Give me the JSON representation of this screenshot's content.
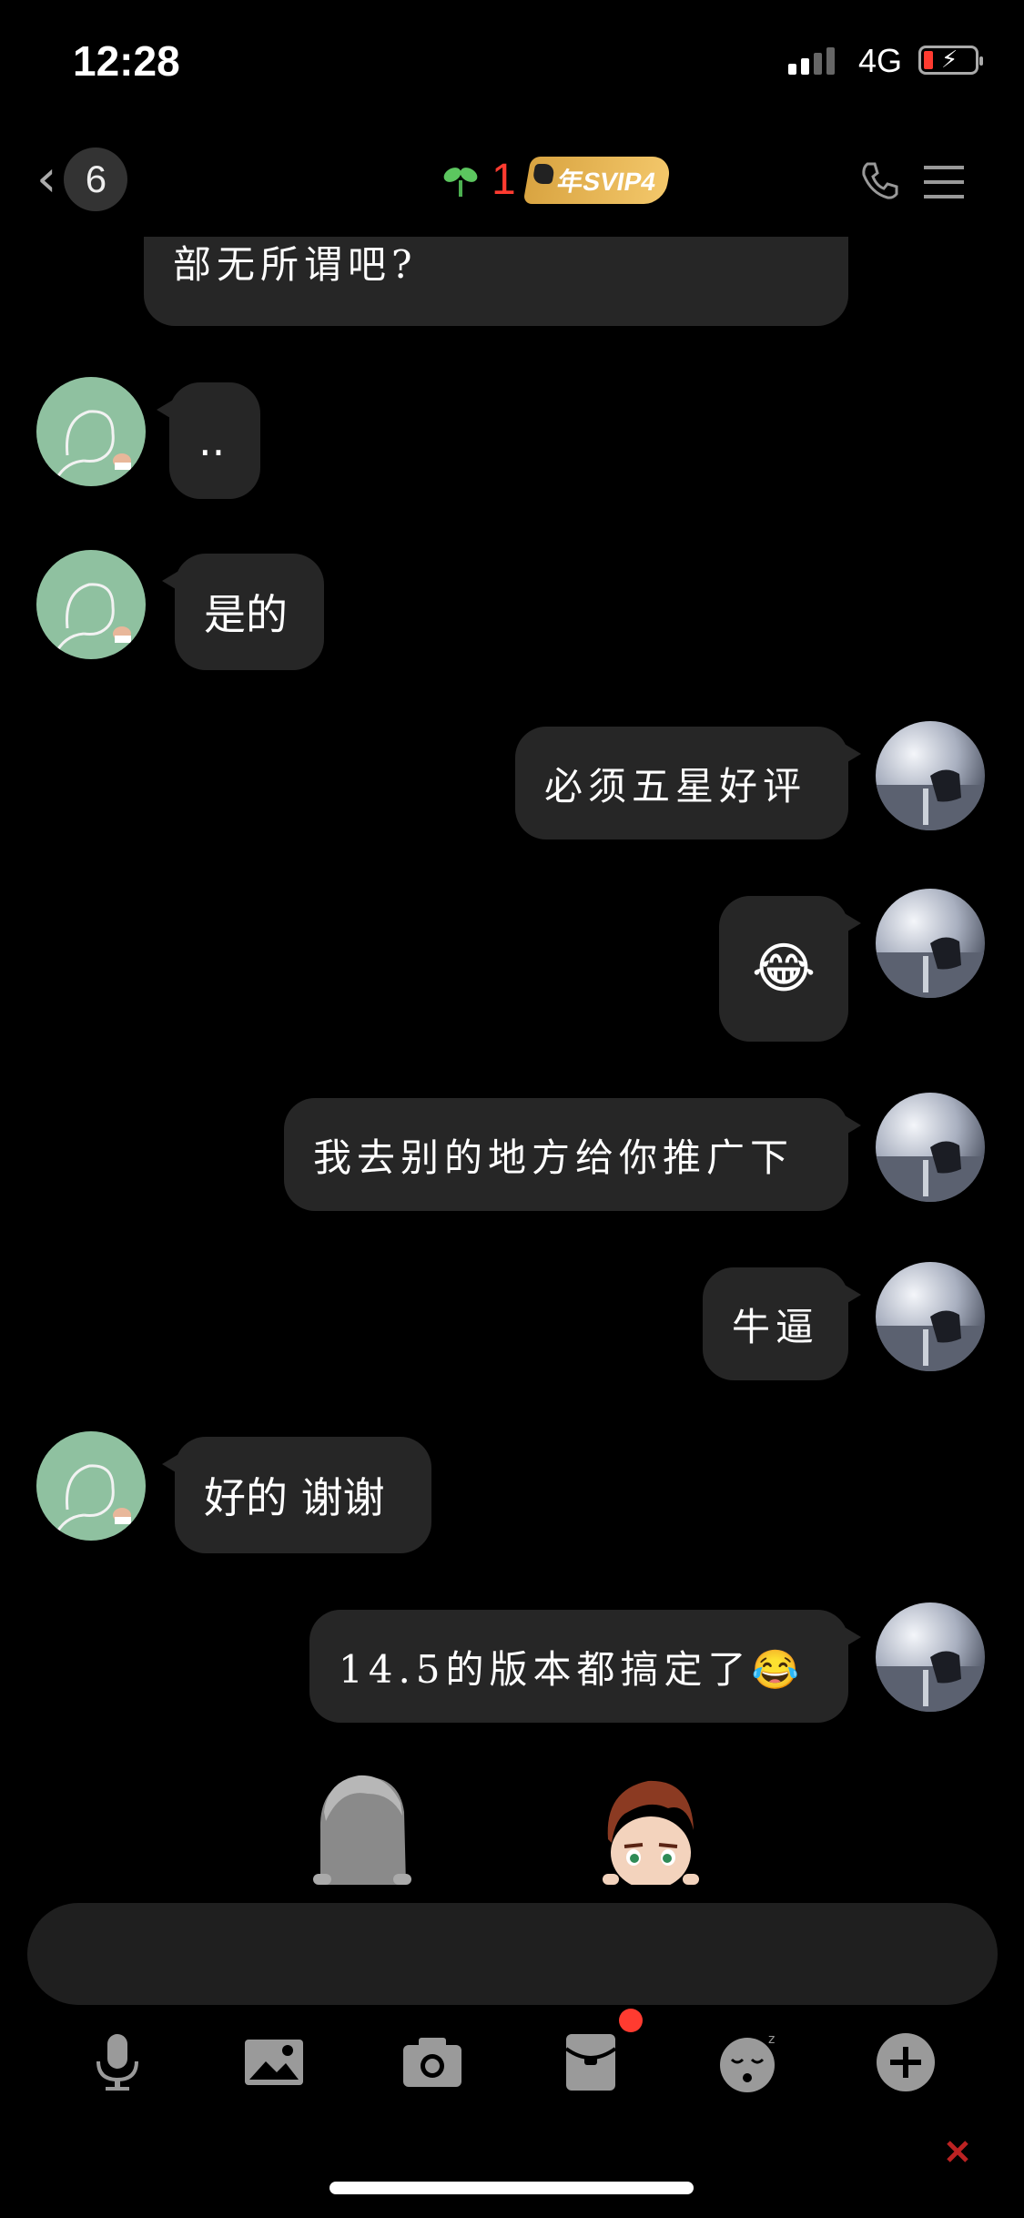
{
  "status_bar": {
    "time": "12:28",
    "network": "4G"
  },
  "nav": {
    "unread_count": "6",
    "level": "1",
    "vip_badge": "年SVIP4"
  },
  "messages": [
    {
      "side": "right",
      "text": "部无所谓吧?"
    },
    {
      "side": "left",
      "text": ".."
    },
    {
      "side": "left",
      "text": "是的"
    },
    {
      "side": "right",
      "text": "必须五星好评"
    },
    {
      "side": "right",
      "text": "😂"
    },
    {
      "side": "right",
      "text": "我去别的地方给你推广下"
    },
    {
      "side": "right",
      "text": "牛逼"
    },
    {
      "side": "left",
      "text": "好的 谢谢"
    },
    {
      "side": "right",
      "text": "14.5的版本都搞定了😂"
    }
  ],
  "input": {
    "value": ""
  },
  "toolbar": {
    "icons": [
      "microphone-icon",
      "image-icon",
      "camera-icon",
      "red-packet-icon",
      "sleepy-emoji-icon",
      "plus-icon"
    ],
    "red_packet_has_notification": true
  },
  "colors": {
    "background": "#000000",
    "bubble": "#262626",
    "accent_red": "#ff3b30",
    "vip_gold": "#e6b453",
    "friend_avatar_green": "#8fc1a0"
  }
}
